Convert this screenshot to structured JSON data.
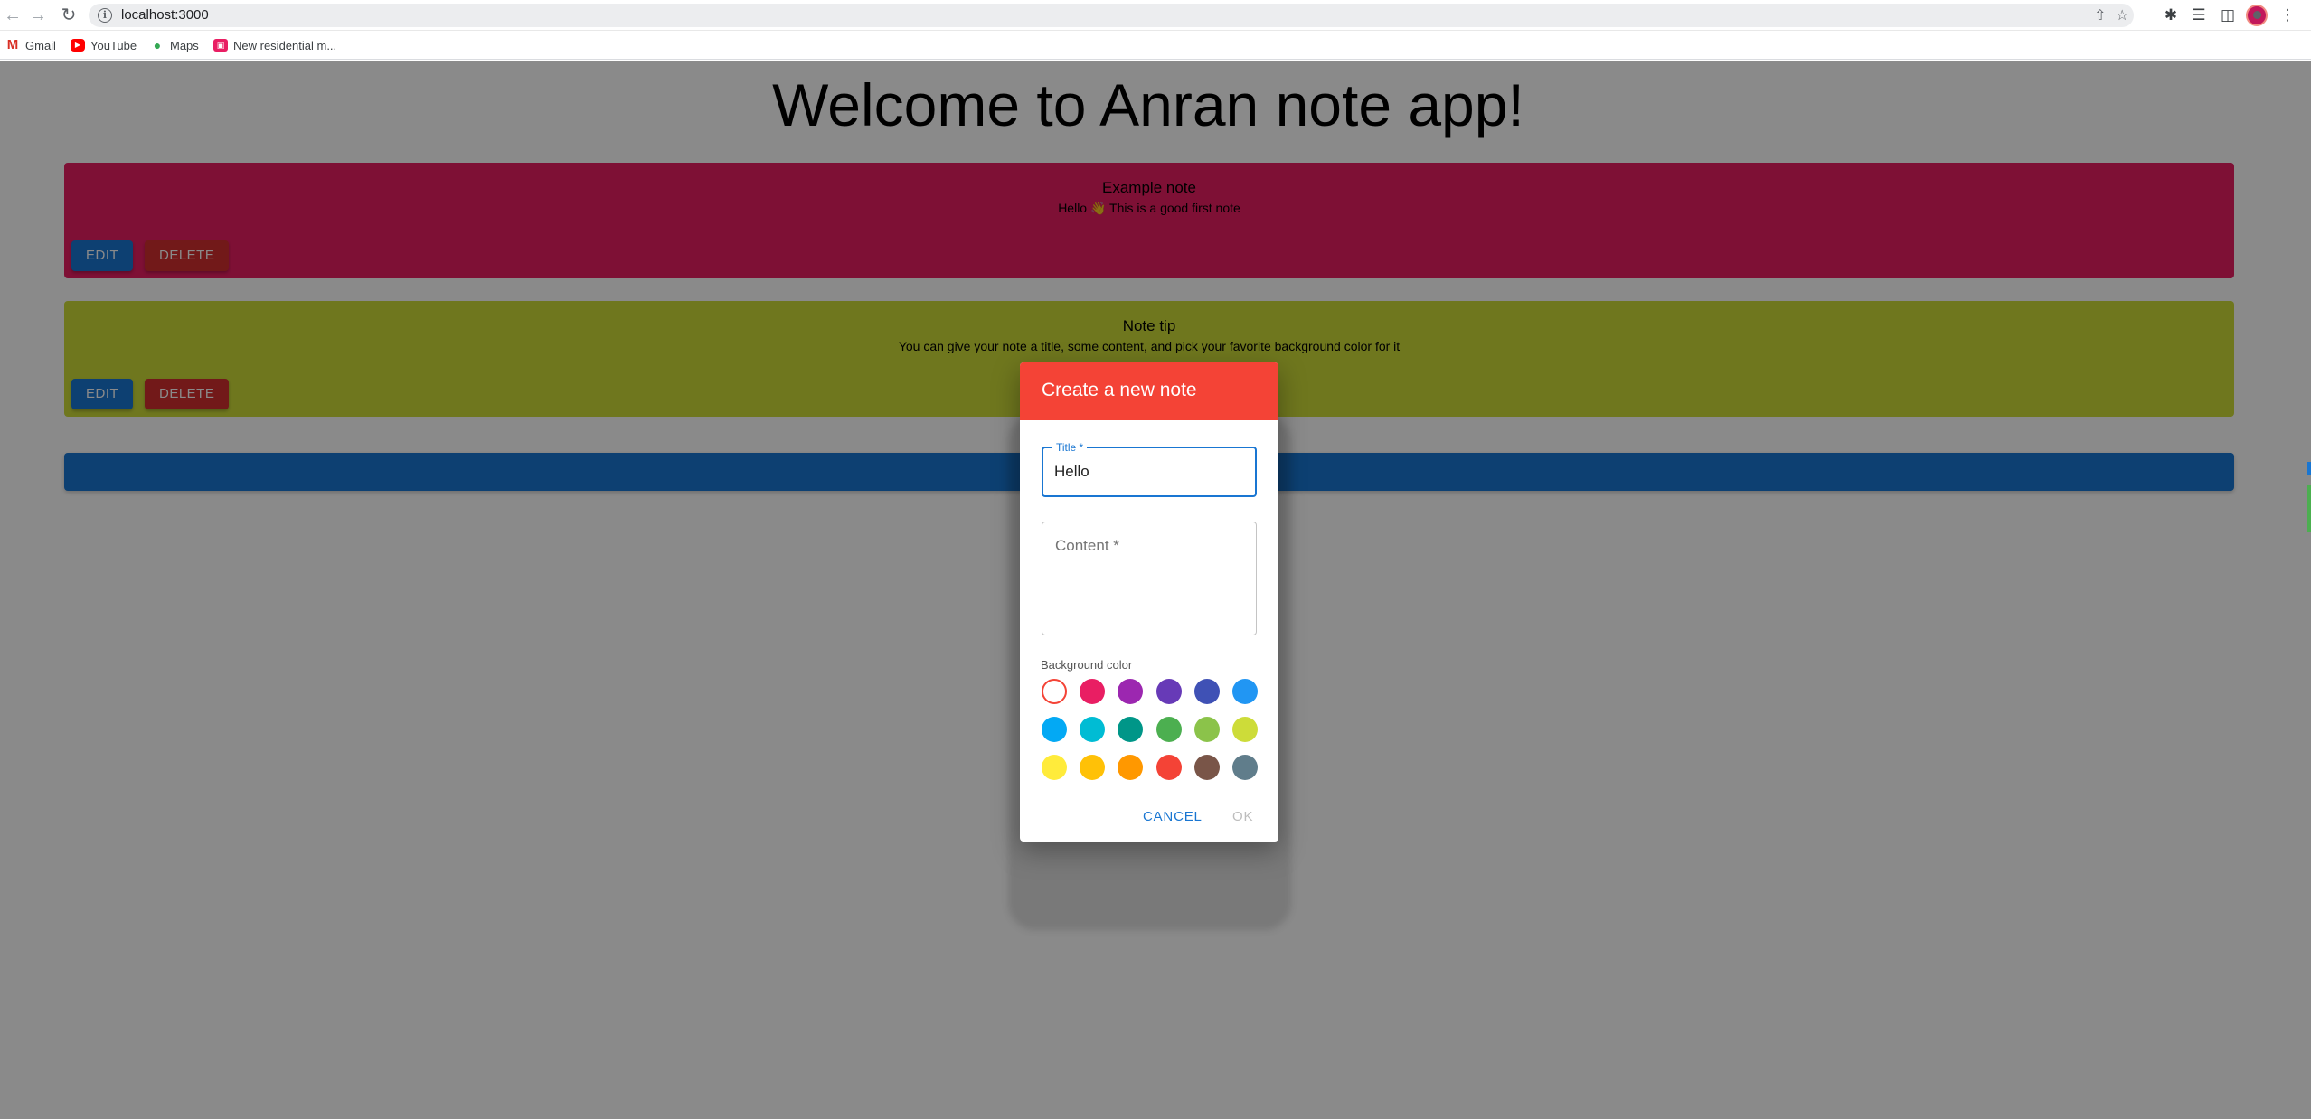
{
  "browser": {
    "url": "localhost:3000",
    "bookmarks": [
      {
        "label": "Gmail",
        "icon": "gmail-icon"
      },
      {
        "label": "YouTube",
        "icon": "youtube-icon"
      },
      {
        "label": "Maps",
        "icon": "maps-icon"
      },
      {
        "label": "New residential m...",
        "icon": "bookmark-favicon"
      }
    ]
  },
  "page": {
    "title": "Welcome to Anran note app!",
    "notes": [
      {
        "title": "Example note",
        "content": "Hello 👋 This is a good first note",
        "color": "#e91e63",
        "edit_label": "EDIT",
        "delete_label": "DELETE"
      },
      {
        "title": "Note tip",
        "content": "You can give your note a title, some content, and pick your favorite background color for it",
        "color": "#cddc39",
        "edit_label": "EDIT",
        "delete_label": "DELETE"
      }
    ],
    "add_bar_color": "#1976d2"
  },
  "dialog": {
    "title": "Create a new note",
    "title_field": {
      "label": "Title *",
      "value": "Hello"
    },
    "content_field": {
      "placeholder": "Content *"
    },
    "background_label": "Background color",
    "colors": [
      [
        "#ffffff",
        "#e91e63",
        "#9c27b0",
        "#673ab7",
        "#3f51b5",
        "#2196f3"
      ],
      [
        "#03a9f4",
        "#00bcd4",
        "#009688",
        "#4caf50",
        "#8bc34a",
        "#cddc39"
      ],
      [
        "#ffeb3b",
        "#ffc107",
        "#ff9800",
        "#f44336",
        "#795548",
        "#607d8b"
      ]
    ],
    "selected_color": "#ffffff",
    "header_color": "#f44336",
    "cancel_label": "CANCEL",
    "ok_label": "OK"
  }
}
